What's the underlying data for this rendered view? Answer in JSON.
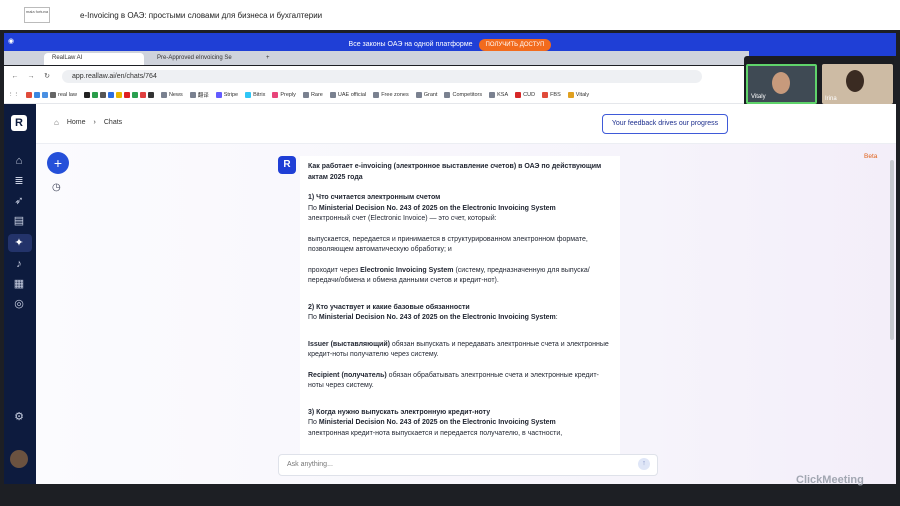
{
  "webinar": {
    "logo_text": "mala fortuna",
    "title": "e-Invoicing в ОАЭ: простыми словами для бизнеса и бухгалтерии",
    "watermark": "ClickMeeting"
  },
  "promo": {
    "text": "Все законы ОАЭ на одной платформе",
    "button": "ПОЛУЧИТЬ ДОСТУП"
  },
  "browser": {
    "tabs": [
      "RealLaw AI",
      "Pre-Approved eInvoicing Se"
    ],
    "url": "app.reallaw.ai/en/chats/764",
    "bookmarks": [
      "real law",
      "News",
      "翻译",
      "Stripe",
      "Bitrix",
      "Preply",
      "Rare",
      "UAE official",
      "Free zones",
      "Grant",
      "Competitors",
      "KSA",
      "CUD",
      "FBS",
      "Vitaly"
    ]
  },
  "video": {
    "participants": [
      "Vitaly",
      "Irina"
    ]
  },
  "app": {
    "breadcrumb": {
      "home": "Home",
      "current": "Chats"
    },
    "feedback_button": "Your feedback drives our progress",
    "beta_label": "Beta",
    "composer_placeholder": "Ask anything...",
    "message": {
      "title": "Как работает e-invoicing (электронное выставление счетов) в ОАЭ по действующим актам 2025 года",
      "s1_heading": "1) Что считается электронным счетом",
      "s1_prefix": "По ",
      "decision": "Ministerial Decision No. 243 of 2025 on the Electronic Invoicing System",
      "s1_text": "электронный счет (Electronic Invoice) — это счет, который:",
      "s1_item1": "выпускается, передается и принимается в структурированном электронном формате, позволяющем автоматическую обработку; и",
      "s1_item2_prefix": "проходит через ",
      "eis": "Electronic Invoicing System",
      "s1_item2_rest": " (систему, предназначенную для выпуска/передачи/обмена и обмена данными счетов и кредит-нот).",
      "s2_heading": "2) Кто участвует и какие базовые обязанности",
      "s2_suffix": ":",
      "issuer": "Issuer (выставляющий)",
      "issuer_text": " обязан выпускать и передавать электронные счета и электронные кредит-ноты получателю через систему.",
      "recipient": "Recipient (получатель)",
      "recipient_text": " обязан обрабатывать электронные счета и электронные кредит-ноты через систему.",
      "s3_heading": "3) Когда нужно выпускать электронную кредит-ноту",
      "s3_text": "электронная кредит-нота выпускается и передается получателю, в частности,"
    }
  }
}
